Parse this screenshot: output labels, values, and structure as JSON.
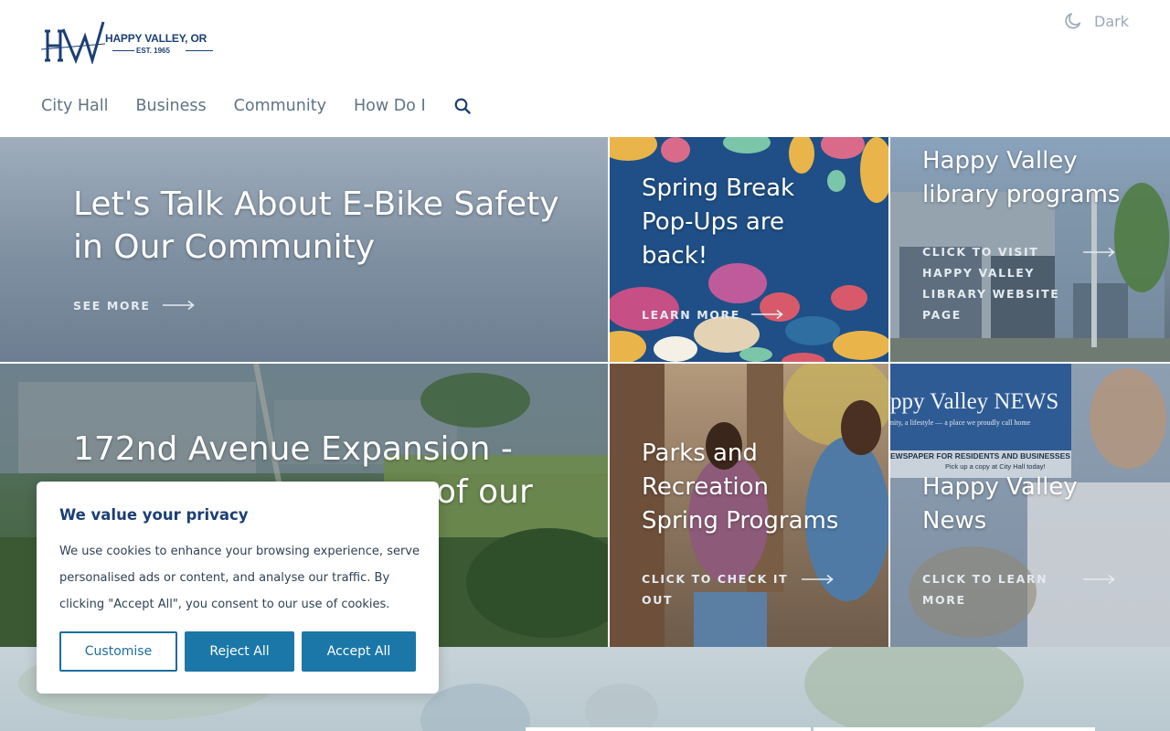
{
  "site": {
    "logo_text": "HAPPY VALLEY, OR",
    "logo_est": "EST. 1965",
    "logo_monogram": "HV"
  },
  "theme_toggle": {
    "label": "Dark",
    "icon": "moon-icon"
  },
  "nav": {
    "items": [
      {
        "label": "City Hall"
      },
      {
        "label": "Business"
      },
      {
        "label": "Community"
      },
      {
        "label": "How Do I"
      }
    ],
    "search_icon": "search-icon"
  },
  "tiles": [
    {
      "title_line1": "Let's Talk About E-Bike Safety",
      "title_line2": "in Our Community",
      "cta": "SEE MORE"
    },
    {
      "title_line1": "Spring Break",
      "title_line2": "Pop-Ups are",
      "title_line3": "back!",
      "cta": "LEARN MORE"
    },
    {
      "title_line1": "Happy Valley",
      "title_line2": "library programs",
      "cta_line1": "CLICK TO VISIT",
      "cta_line2": "HAPPY VALLEY",
      "cta_line3": "LIBRARY WEBSITE",
      "cta_line4": "PAGE"
    },
    {
      "title_line1": "172nd Avenue Expansion -",
      "title_line2": "of our"
    },
    {
      "title_line1": "Parks and",
      "title_line2": "Recreation",
      "title_line3": "Spring Programs",
      "cta_line1": "CLICK TO CHECK IT",
      "cta_line2": "OUT"
    },
    {
      "title_line1": "Happy Valley",
      "title_line2": "News",
      "cta_line1": "CLICK TO LEARN",
      "cta_line2": "MORE",
      "image_masthead": "ppy Valley NEWS",
      "image_tagline": "nity, a lifestyle — a place we proudly call home",
      "image_sub1": "EWSPAPER FOR RESIDENTS AND BUSINESSES",
      "image_sub2": "Pick up a copy at City Hall today!"
    }
  ],
  "cookie_banner": {
    "title": "We value your privacy",
    "body": "We use cookies to enhance your browsing experience, serve personalised ads or content, and analyse our traffic. By clicking \"Accept All\", you consent to our use of cookies.",
    "customise_label": "Customise",
    "reject_label": "Reject All",
    "accept_label": "Accept All"
  },
  "colors": {
    "brand_navy": "#1c3f74",
    "nav_text": "#5f7486",
    "button_blue": "#1b77a7"
  }
}
